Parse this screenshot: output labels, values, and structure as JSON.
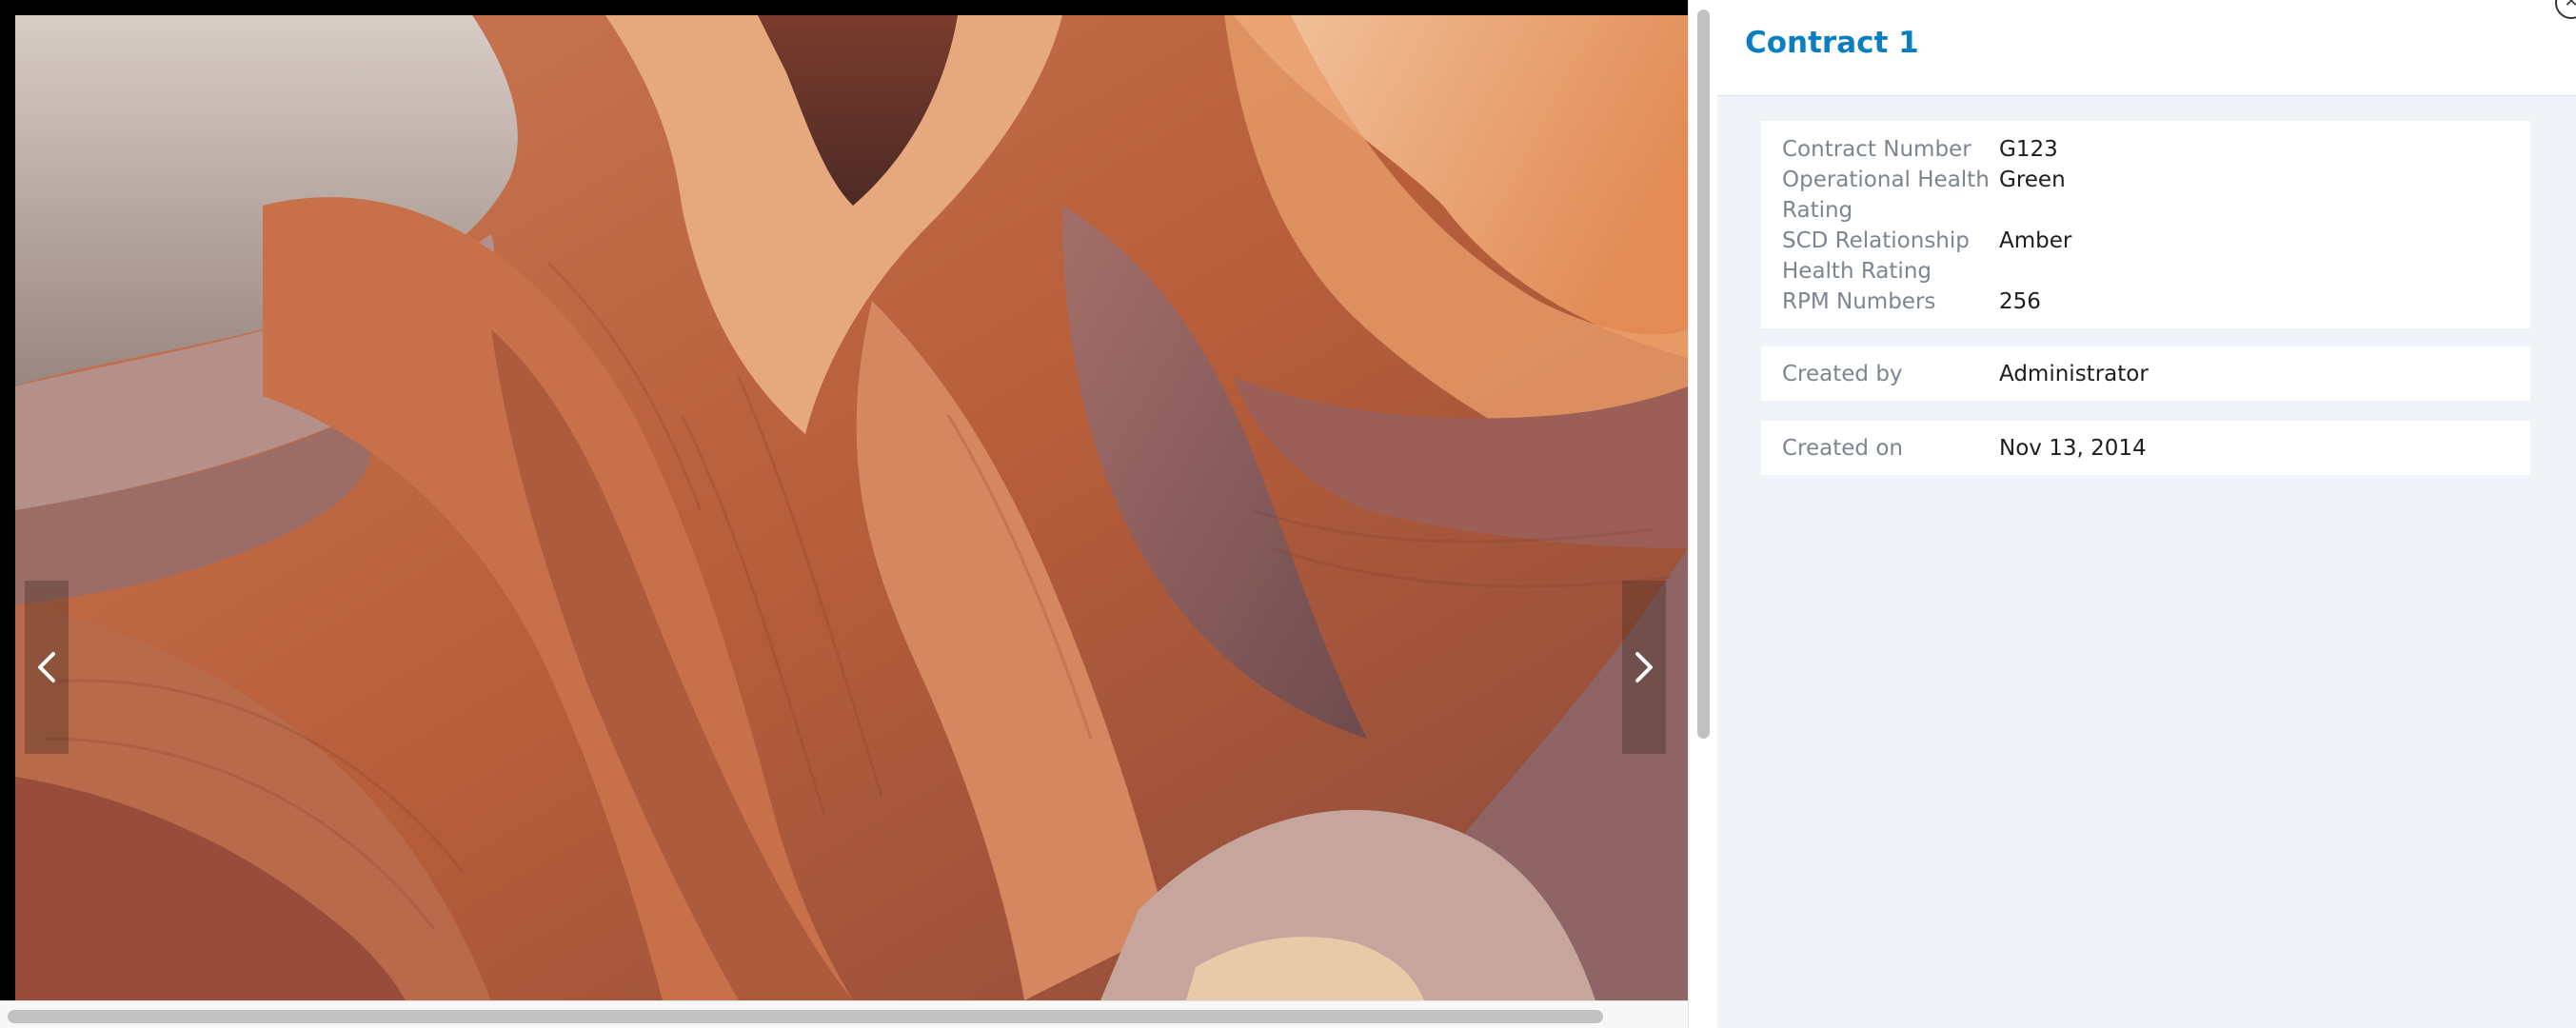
{
  "panel": {
    "title": "Contract 1",
    "close_icon": "close-icon",
    "attributes": [
      {
        "label": "Contract Number",
        "value": "G123"
      },
      {
        "label": "Operational Health Rating",
        "value": "Green"
      },
      {
        "label": "SCD Relationship Health Rating",
        "value": "Amber"
      },
      {
        "label": "RPM Numbers",
        "value": "256"
      }
    ],
    "created_by": {
      "label": "Created by",
      "value": "Administrator"
    },
    "created_on": {
      "label": "Created on",
      "value": "Nov 13, 2014"
    }
  },
  "viewer": {
    "prev_icon": "chevron-left-icon",
    "next_icon": "chevron-right-icon"
  },
  "colors": {
    "title": "#0a7ec2",
    "panel_bg": "#f0f3f7",
    "label": "#7c8590",
    "value": "#1d1d1d"
  }
}
